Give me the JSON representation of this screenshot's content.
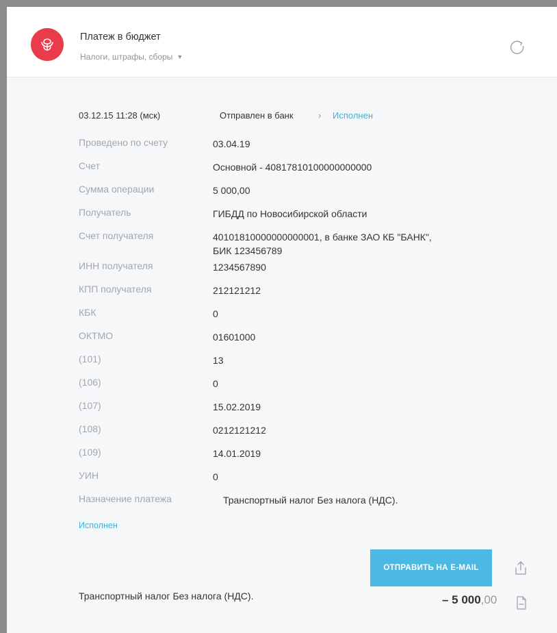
{
  "header": {
    "title": "Платеж в бюджет",
    "subtitle": "Налоги, штрафы, сборы",
    "logo_color": "#ea3b4b"
  },
  "status": {
    "datetime": "03.12.15 11:28 (мск)",
    "sent": "Отправлен в банк",
    "arrow": "›",
    "done": "Исполнен"
  },
  "details": [
    {
      "label": "Проведено по счету",
      "value": "03.04.19"
    },
    {
      "label": "Счет",
      "value": "Основной - 40817810100000000000"
    },
    {
      "label": "Сумма операции",
      "value": "5 000,00"
    },
    {
      "label": "Получатель",
      "value": "ГИБДД по Новосибирской области"
    },
    {
      "label": "Счет получателя",
      "value": "40101810000000000001, в банке ЗАО КБ \"БАНК\",",
      "value2": "БИК 123456789"
    },
    {
      "label": "ИНН получателя",
      "value": "1234567890"
    },
    {
      "label": "КПП получателя",
      "value": "212121212"
    },
    {
      "label": "КБК",
      "value": "0"
    },
    {
      "label": "ОКТМО",
      "value": "01601000"
    },
    {
      "label": "(101)",
      "value": "13"
    },
    {
      "label": "(106)",
      "value": "0"
    },
    {
      "label": "(107)",
      "value": "15.02.2019"
    },
    {
      "label": "(108)",
      "value": "0212121212"
    },
    {
      "label": "(109)",
      "value": "14.01.2019"
    },
    {
      "label": "УИН",
      "value": "0"
    },
    {
      "label": "Назначение платежа",
      "value": "Транспортный налог Без налога (НДС)."
    }
  ],
  "status_link": "Исполнен",
  "actions": {
    "email_button": "ОТПРАВИТЬ НА E-MAIL",
    "accent": "#4bb9e4"
  },
  "footer": {
    "description": "Транспортный налог Без налога (НДС).",
    "amount_int": "– 5 000",
    "amount_dec": ",00"
  }
}
